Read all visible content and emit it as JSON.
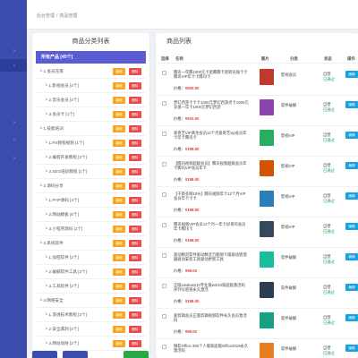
{
  "breadcrumb": {
    "home": "后台管理",
    "separator": "/",
    "current": "商品管理"
  },
  "categories": {
    "title": "商品分类列表",
    "root_label": "所有产品 [45个]",
    "edit_label": "编辑",
    "delete_label": "删除",
    "items": [
      {
        "label": "└ 1.会员充值",
        "level": 1
      },
      {
        "label": "└ 1.影视会员 [4个]",
        "level": 2
      },
      {
        "label": "└ 2.音乐会员 [4个]",
        "level": 2
      },
      {
        "label": "└ 3.会员卡 [1个]",
        "level": 2
      },
      {
        "label": "└ 1.技能培训",
        "level": 1
      },
      {
        "label": "└ 1.PS教程视频 [1个]",
        "level": 2
      },
      {
        "label": "└ 2.编程开发教程 [2个]",
        "level": 2
      },
      {
        "label": "└ 3.SEO培训教程 [1个]",
        "level": 2
      },
      {
        "label": "└ 2.源码分享",
        "level": 1
      },
      {
        "label": "└ 1.PHP源码 [4个]",
        "level": 2
      },
      {
        "label": "└ 2.网站模板 [6个]",
        "level": 2
      },
      {
        "label": "└ 3.小程序源码 [1个]",
        "level": 2
      },
      {
        "label": "└ 3.系统软件",
        "level": 1
      },
      {
        "label": "└ 1.加密软件 [2个]",
        "level": 2
      },
      {
        "label": "└ 2.破解软件工具 [2个]",
        "level": 2
      },
      {
        "label": "└ 3.工具软件 [2个]",
        "level": 2
      },
      {
        "label": "└ 4.网络安全",
        "level": 1
      },
      {
        "label": "└ 1.渗透技术教程 [2个]",
        "level": 2
      },
      {
        "label": "└ 2.安全漏洞 [4个]",
        "level": 2
      },
      {
        "label": "└ 3.网站攻防 [2个]",
        "level": 2
      }
    ]
  },
  "products": {
    "title": "商品列表",
    "headers": {
      "select": "选择",
      "name": "名称",
      "image": "图片",
      "category": "分类",
      "status": "状态",
      "action": "操作"
    },
    "price_prefix": "价格：",
    "status_sub": "已通过",
    "edit_label": "编辑",
    "rows": [
      {
        "name": "腾讯一年腾1000元卡密腾腾卡密转充值卡卡腾讯VIP年卡卡腾讯卡",
        "price": "¥930.00",
        "category": "影视会员",
        "status": "自营",
        "thumb_color": "#c0392b"
      },
      {
        "name": "梦幻西游卡卡卡1000元梦幻西游点卡1000元充值一年卡1000元梦幻西游",
        "price": "¥910.00",
        "category": "软件破解",
        "status": "自营",
        "thumb_color": "#8e44ad"
      },
      {
        "name": "爱奇艺VIP黄金会员12个月爱奇艺vip会员年卡年卡腾讯卡",
        "price": "¥198.00",
        "category": "影视VIP",
        "status": "自营",
        "thumb_color": "#27ae60"
      },
      {
        "name": "【腾讯视频超级会员】腾讯视频超级会员年卡腾讯VIP会员年卡",
        "price": "¥198.00",
        "category": "影视VIP",
        "status": "自营",
        "thumb_color": "#d35400"
      },
      {
        "name": "【千斯衣网10%】腾讯视频年卡12个月VIP会员年卡卡卡",
        "price": "¥198.00",
        "category": "影视VIP",
        "status": "自营",
        "thumb_color": "#2980b9"
      },
      {
        "name": "腾讯视频VIP会员12个月一年卡好莱坞会员年卡腾讯卡",
        "price": "¥198.00",
        "category": "影视VIP",
        "status": "自营",
        "thumb_color": "#34495e"
      },
      {
        "name": "驱动精灵软件驱动精灵万能网卡版驱动管理器驱动安装工具驱动更新工具",
        "price": "¥98.00",
        "category": "软件破解",
        "status": "自营",
        "thumb_color": "#1abc9c"
      },
      {
        "name": "正版windows10专业版win10家庭版激活码序列号密钥永久激活",
        "price": "¥198.00",
        "category": "软件破解",
        "status": "自营",
        "thumb_color": "#2c3e50"
      },
      {
        "name": "爱剪辑会员正版剪辑视频软件永久会员激活码",
        "price": "¥98.00",
        "category": "软件破解",
        "status": "自营",
        "thumb_color": "#16a085"
      },
      {
        "name": "微软Office 365个人版家庭版Office2019永久激活码",
        "price": "¥198.00",
        "category": "软件破解",
        "status": "自营",
        "thumb_color": "#e67e22"
      }
    ]
  }
}
